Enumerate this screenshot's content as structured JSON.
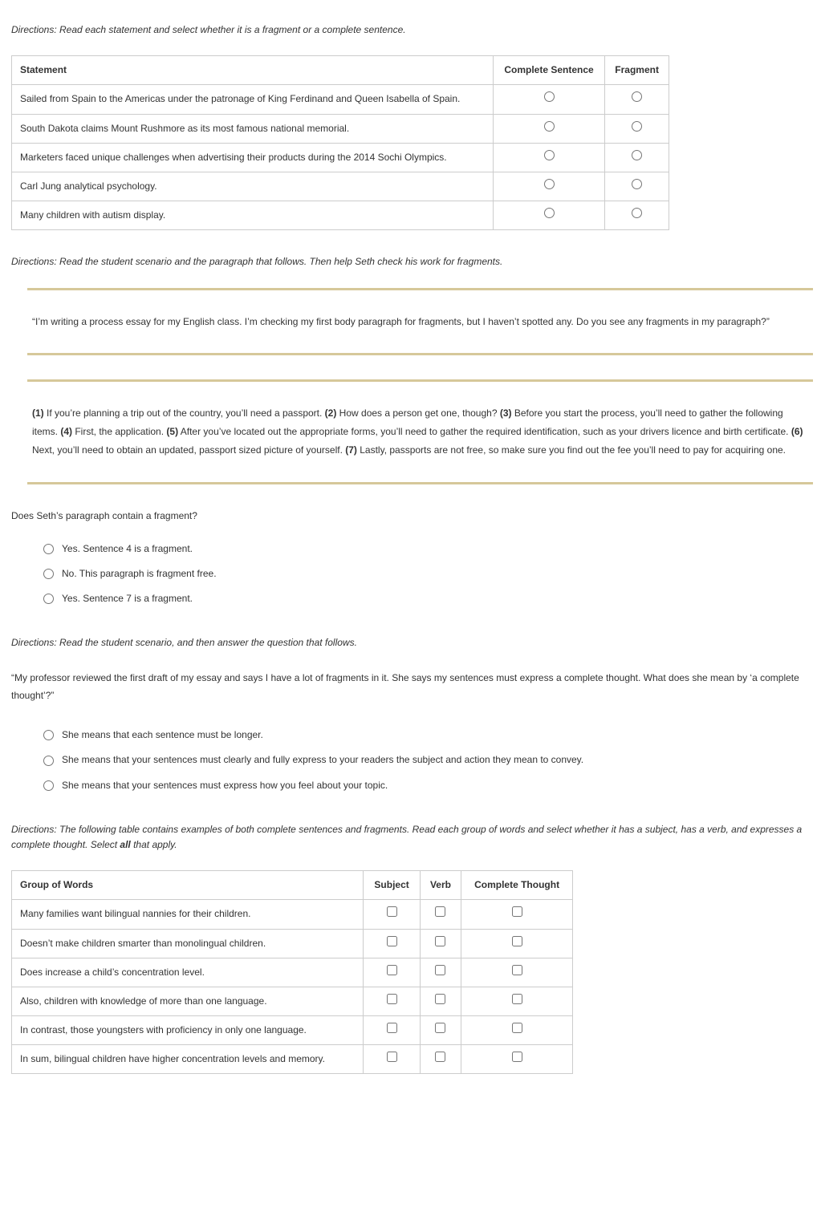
{
  "section1": {
    "directions": "Directions: Read each statement and select whether it is a fragment or a complete sentence.",
    "headers": {
      "statement": "Statement",
      "complete": "Complete Sentence",
      "fragment": "Fragment"
    },
    "rows": [
      {
        "text": "Sailed from Spain to the Americas under the patronage of King Ferdinand and Queen Isabella of Spain."
      },
      {
        "text": "South Dakota claims Mount Rushmore as its most famous national memorial."
      },
      {
        "text": "Marketers faced unique challenges when advertising their products during the 2014 Sochi Olympics."
      },
      {
        "text": "Carl Jung analytical psychology."
      },
      {
        "text": "Many children with autism display."
      }
    ]
  },
  "section2": {
    "directions": "Directions: Read the student scenario and the paragraph that follows. Then help Seth check his work for fragments.",
    "scenario": "“I’m writing a process essay for my English class. I’m checking my first body paragraph for fragments, but I haven’t spotted any. Do you see any fragments in my paragraph?”",
    "paragraph": {
      "s1": " If you’re planning a trip out of the country, you’ll need a passport. ",
      "s2": " How does a person get one, though? ",
      "s3": " Before you start the process, you’ll need to gather the following items. ",
      "s4": " First, the application. ",
      "s5": " After you’ve located out the appropriate forms, you’ll need to gather the required identification, such as your drivers licence and birth certificate. ",
      "s6": " Next, you’ll need to obtain an updated, passport sized picture of yourself. ",
      "s7": " Lastly, passports are not free, so make sure you find out the fee you’ll need to pay for acquiring one.",
      "n1": "(1)",
      "n2": "(2)",
      "n3": "(3)",
      "n4": "(4)",
      "n5": "(5)",
      "n6": "(6)",
      "n7": "(7)"
    },
    "question": "Does Seth’s paragraph contain a fragment?",
    "options": [
      "Yes. Sentence 4 is a fragment.",
      "No. This paragraph is fragment free.",
      "Yes. Sentence 7 is a fragment."
    ]
  },
  "section3": {
    "directions": "Directions: Read the student scenario, and then answer the question that follows.",
    "scenario": "“My professor reviewed the first draft of my essay and says I have a lot of fragments in it. She says my sentences must express a complete thought. What does she mean by ‘a complete thought’?”",
    "options": [
      "She means that each sentence must be longer.",
      "She means that your sentences must clearly and fully express to your readers the subject and action they mean to convey.",
      "She means that your sentences must express how you feel about your topic."
    ]
  },
  "section4": {
    "directions_pre": "Directions: The following table contains examples of both complete sentences and fragments. Read each group of words and select whether it has a subject, has a verb, and expresses a complete thought. Select ",
    "directions_bold": "all",
    "directions_post": " that apply.",
    "headers": {
      "group": "Group of Words",
      "subject": "Subject",
      "verb": "Verb",
      "thought": "Complete Thought"
    },
    "rows": [
      {
        "text": "Many families want bilingual nannies for their children."
      },
      {
        "text": "Doesn’t make children smarter than monolingual children."
      },
      {
        "text": "Does increase a child’s concentration level."
      },
      {
        "text": "Also, children with knowledge of more than one language."
      },
      {
        "text": "In contrast, those youngsters with proficiency in only one language."
      },
      {
        "text": "In sum, bilingual children have higher concentration levels and memory."
      }
    ]
  }
}
